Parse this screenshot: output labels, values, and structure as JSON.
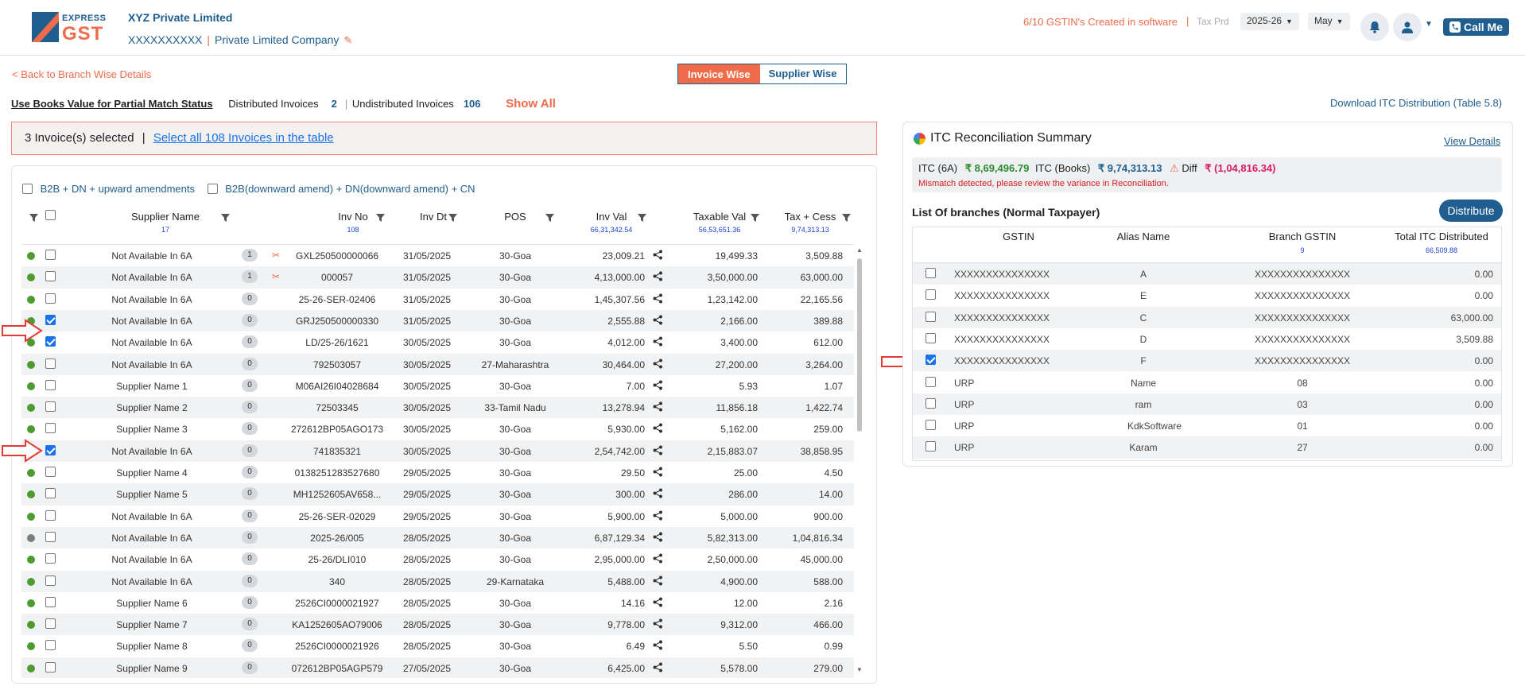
{
  "header": {
    "logo_top": "EXPRESS",
    "logo_bottom": "GST",
    "company_name": "XYZ Private Limited",
    "gstin": "XXXXXXXXXX",
    "company_type": "Private Limited Company",
    "gstin_created": "6/10 GSTIN's Created in software",
    "tax_prd_label": "Tax Prd",
    "fy": "2025-26",
    "month": "May",
    "call_me": "Call Me"
  },
  "subbar": {
    "back_link": "< Back to Branch Wise Details",
    "tab_invoice": "Invoice Wise",
    "tab_supplier": "Supplier Wise",
    "books_value": "Use Books Value for Partial Match Status",
    "distributed_label": "Distributed Invoices",
    "distributed_count": "2",
    "undistributed_label": "Undistributed Invoices",
    "undistributed_count": "106",
    "show_all": "Show All",
    "download": "Download ITC Distribution (Table 5.8)"
  },
  "selection": {
    "selected_text": "3 Invoice(s) selected",
    "sep": "|",
    "select_all": "Select all 108 Invoices in the table"
  },
  "filters": {
    "f1": "B2B + DN + upward amendments",
    "f2": "B2B(downward amend) + DN(downward amend) + CN"
  },
  "table": {
    "headers": {
      "supplier": "Supplier Name",
      "supplier_count": "17",
      "inv_no": "Inv No",
      "inv_count": "108",
      "inv_dt": "Inv Dt",
      "pos": "POS",
      "inv_val": "Inv Val",
      "inv_val_total": "66,31,342.54",
      "taxable": "Taxable Val",
      "taxable_total": "56,53,651.36",
      "tax": "Tax + Cess",
      "tax_total": "9,74,313.13"
    },
    "rows": [
      {
        "dot": "green",
        "checked": false,
        "supplier": "Not Available In 6A",
        "badge": "1",
        "scissor": true,
        "inv": "GXL250500000066",
        "dt": "31/05/2025",
        "pos": "30-Goa",
        "val": "23,009.21",
        "tax": "19,499.33",
        "cess": "3,509.88"
      },
      {
        "dot": "green",
        "checked": false,
        "supplier": "Not Available In 6A",
        "badge": "1",
        "scissor": true,
        "inv": "000057",
        "dt": "31/05/2025",
        "pos": "30-Goa",
        "val": "4,13,000.00",
        "tax": "3,50,000.00",
        "cess": "63,000.00"
      },
      {
        "dot": "green",
        "checked": false,
        "supplier": "Not Available In 6A",
        "badge": "0",
        "scissor": false,
        "inv": "25-26-SER-02406",
        "dt": "31/05/2025",
        "pos": "30-Goa",
        "val": "1,45,307.56",
        "tax": "1,23,142.00",
        "cess": "22,165.56"
      },
      {
        "dot": "green",
        "checked": true,
        "supplier": "Not Available In 6A",
        "badge": "0",
        "scissor": false,
        "inv": "GRJ250500000330",
        "dt": "31/05/2025",
        "pos": "30-Goa",
        "val": "2,555.88",
        "tax": "2,166.00",
        "cess": "389.88"
      },
      {
        "dot": "green",
        "checked": true,
        "supplier": "Not Available In 6A",
        "badge": "0",
        "scissor": false,
        "inv": "LD/25-26/1621",
        "dt": "30/05/2025",
        "pos": "30-Goa",
        "val": "4,012.00",
        "tax": "3,400.00",
        "cess": "612.00"
      },
      {
        "dot": "green",
        "checked": false,
        "supplier": "Not Available In 6A",
        "badge": "0",
        "scissor": false,
        "inv": "792503057",
        "dt": "30/05/2025",
        "pos": "27-Maharashtra",
        "val": "30,464.00",
        "tax": "27,200.00",
        "cess": "3,264.00"
      },
      {
        "dot": "green",
        "checked": false,
        "supplier": "Supplier Name 1",
        "badge": "0",
        "scissor": false,
        "inv": "M06AI26I04028684",
        "dt": "30/05/2025",
        "pos": "30-Goa",
        "val": "7.00",
        "tax": "5.93",
        "cess": "1.07"
      },
      {
        "dot": "green",
        "checked": false,
        "supplier": "Supplier Name 2",
        "badge": "0",
        "scissor": false,
        "inv": "72503345",
        "dt": "30/05/2025",
        "pos": "33-Tamil Nadu",
        "val": "13,278.94",
        "tax": "11,856.18",
        "cess": "1,422.74"
      },
      {
        "dot": "green",
        "checked": false,
        "supplier": "Supplier Name 3",
        "badge": "0",
        "scissor": false,
        "inv": "272612BP05AGO173",
        "dt": "30/05/2025",
        "pos": "30-Goa",
        "val": "5,930.00",
        "tax": "5,162.00",
        "cess": "259.00"
      },
      {
        "dot": "green",
        "checked": true,
        "supplier": "Not Available In 6A",
        "badge": "0",
        "scissor": false,
        "inv": "741835321",
        "dt": "30/05/2025",
        "pos": "30-Goa",
        "val": "2,54,742.00",
        "tax": "2,15,883.07",
        "cess": "38,858.95"
      },
      {
        "dot": "green",
        "checked": false,
        "supplier": "Supplier Name 4",
        "badge": "0",
        "scissor": false,
        "inv": "0138251283527680",
        "dt": "29/05/2025",
        "pos": "30-Goa",
        "val": "29.50",
        "tax": "25.00",
        "cess": "4.50"
      },
      {
        "dot": "green",
        "checked": false,
        "supplier": "Supplier Name 5",
        "badge": "0",
        "scissor": false,
        "inv": "MH1252605AV658...",
        "dt": "29/05/2025",
        "pos": "30-Goa",
        "val": "300.00",
        "tax": "286.00",
        "cess": "14.00"
      },
      {
        "dot": "green",
        "checked": false,
        "supplier": "Not Available In 6A",
        "badge": "0",
        "scissor": false,
        "inv": "25-26-SER-02029",
        "dt": "29/05/2025",
        "pos": "30-Goa",
        "val": "5,900.00",
        "tax": "5,000.00",
        "cess": "900.00"
      },
      {
        "dot": "grey",
        "checked": false,
        "supplier": "Not Available In 6A",
        "badge": "0",
        "scissor": false,
        "inv": "2025-26/005",
        "dt": "28/05/2025",
        "pos": "30-Goa",
        "val": "6,87,129.34",
        "tax": "5,82,313.00",
        "cess": "1,04,816.34"
      },
      {
        "dot": "green",
        "checked": false,
        "supplier": "Not Available In 6A",
        "badge": "0",
        "scissor": false,
        "inv": "25-26/DLI010",
        "dt": "28/05/2025",
        "pos": "30-Goa",
        "val": "2,95,000.00",
        "tax": "2,50,000.00",
        "cess": "45,000.00"
      },
      {
        "dot": "green",
        "checked": false,
        "supplier": "Not Available In 6A",
        "badge": "0",
        "scissor": false,
        "inv": "340",
        "dt": "28/05/2025",
        "pos": "29-Karnataka",
        "val": "5,488.00",
        "tax": "4,900.00",
        "cess": "588.00"
      },
      {
        "dot": "green",
        "checked": false,
        "supplier": "Supplier Name 6",
        "badge": "0",
        "scissor": false,
        "inv": "2526CI0000021927",
        "dt": "28/05/2025",
        "pos": "30-Goa",
        "val": "14.16",
        "tax": "12.00",
        "cess": "2.16"
      },
      {
        "dot": "green",
        "checked": false,
        "supplier": "Supplier Name 7",
        "badge": "0",
        "scissor": false,
        "inv": "KA1252605AO79006",
        "dt": "28/05/2025",
        "pos": "30-Goa",
        "val": "9,778.00",
        "tax": "9,312.00",
        "cess": "466.00"
      },
      {
        "dot": "green",
        "checked": false,
        "supplier": "Supplier Name 8",
        "badge": "0",
        "scissor": false,
        "inv": "2526CI0000021926",
        "dt": "28/05/2025",
        "pos": "30-Goa",
        "val": "6.49",
        "tax": "5.50",
        "cess": "0.99"
      },
      {
        "dot": "green",
        "checked": false,
        "supplier": "Supplier Name 9",
        "badge": "0",
        "scissor": false,
        "inv": "072612BP05AGP579",
        "dt": "27/05/2025",
        "pos": "30-Goa",
        "val": "6,425.00",
        "tax": "5,578.00",
        "cess": "279.00"
      }
    ]
  },
  "summary": {
    "title": "ITC Reconciliation Summary",
    "view_details": "View Details",
    "itc_6a_label": "ITC (6A)",
    "itc_6a_value": "₹ 8,69,496.79",
    "itc_books_label": "ITC (Books)",
    "itc_books_value": "₹ 9,74,313.13",
    "diff_label": "Diff",
    "diff_value": "₹ (1,04,816.34)",
    "mismatch": "Mismatch detected, please review the variance in Reconciliation.",
    "branches_title": "List Of branches (Normal Taxpayer)",
    "distribute": "Distribute",
    "headers": {
      "gstin": "GSTIN",
      "alias": "Alias Name",
      "branch": "Branch GSTIN",
      "branch_count": "9",
      "total": "Total ITC Distributed",
      "total_sum": "66,509.88"
    },
    "rows": [
      {
        "checked": false,
        "gstin": "XXXXXXXXXXXXXXX",
        "alias": "A",
        "branch": "XXXXXXXXXXXXXXX",
        "total": "0.00"
      },
      {
        "checked": false,
        "gstin": "XXXXXXXXXXXXXXX",
        "alias": "E",
        "branch": "XXXXXXXXXXXXXXX",
        "total": "0.00"
      },
      {
        "checked": false,
        "gstin": "XXXXXXXXXXXXXXX",
        "alias": "C",
        "branch": "XXXXXXXXXXXXXXX",
        "total": "63,000.00"
      },
      {
        "checked": false,
        "gstin": "XXXXXXXXXXXXXXX",
        "alias": "D",
        "branch": "XXXXXXXXXXXXXXX",
        "total": "3,509.88"
      },
      {
        "checked": true,
        "gstin": "XXXXXXXXXXXXXXX",
        "alias": "F",
        "branch": "XXXXXXXXXXXXXXX",
        "total": "0.00"
      },
      {
        "checked": false,
        "gstin": "URP",
        "alias": "Name",
        "branch": "08",
        "total": "0.00"
      },
      {
        "checked": false,
        "gstin": "URP",
        "alias": "ram",
        "branch": "03",
        "total": "0.00"
      },
      {
        "checked": false,
        "gstin": "URP",
        "alias": "KdkSoftware",
        "branch": "01",
        "total": "0.00"
      },
      {
        "checked": false,
        "gstin": "URP",
        "alias": "Karam",
        "branch": "27",
        "total": "0.00"
      }
    ]
  },
  "colors": {
    "brand_blue": "#1f5e8f",
    "accent_orange": "#ef6c4a",
    "status_green": "#4c9b2f",
    "checkbox_blue": "#1a73e8"
  }
}
